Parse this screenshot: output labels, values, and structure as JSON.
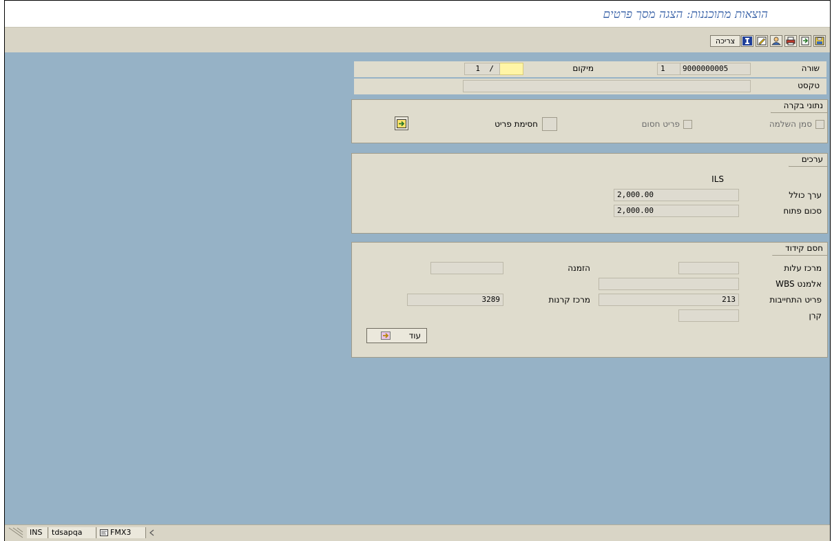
{
  "window": {
    "title": "הוצאות מתוכננות: הצגה מסך פרטים"
  },
  "toolbar": {
    "create_label": "צריכה",
    "icons": [
      "save-icon",
      "export-icon",
      "print-icon",
      "user-icon",
      "edit-icon",
      "info-icon"
    ]
  },
  "header": {
    "row_label": "שורה",
    "row_number": "1",
    "document_number": "9000000005",
    "location_label": "מיקום",
    "location_value": "",
    "location_page": "1",
    "location_sep": "/",
    "text_label": "טקסט",
    "text_value": ""
  },
  "control": {
    "title": "נתוני בקרה",
    "completion_flag_label": "סמן השלמה",
    "blocked_item_label": "פריט חסום",
    "item_block_label": "חסימת פריט"
  },
  "values": {
    "title": "ערכים",
    "currency": "ILS",
    "total_value_label": "ערך כולל",
    "total_value": "2,000.00",
    "open_amount_label": "סכום פתוח",
    "open_amount": "2,000.00"
  },
  "coding": {
    "title": "חסם קידוד",
    "cost_center_label": "מרכז עלות",
    "cost_center_value": "",
    "order_label": "הזמנה",
    "order_value": "",
    "wbs_label": "אלמנט WBS",
    "wbs_value": "",
    "commitment_item_label": "פריט התחייבות",
    "commitment_item_value": "213",
    "funds_center_label": "מרכז קרנות",
    "funds_center_value": "3289",
    "fund_label": "קרן",
    "fund_value": "",
    "more_label": "עוד"
  },
  "status": {
    "mode": "INS",
    "server": "tdsapqa",
    "transaction": "FMX3"
  },
  "colors": {
    "background": "#96b2c6",
    "panel": "#dfdccd",
    "title": "#3a63a8"
  }
}
